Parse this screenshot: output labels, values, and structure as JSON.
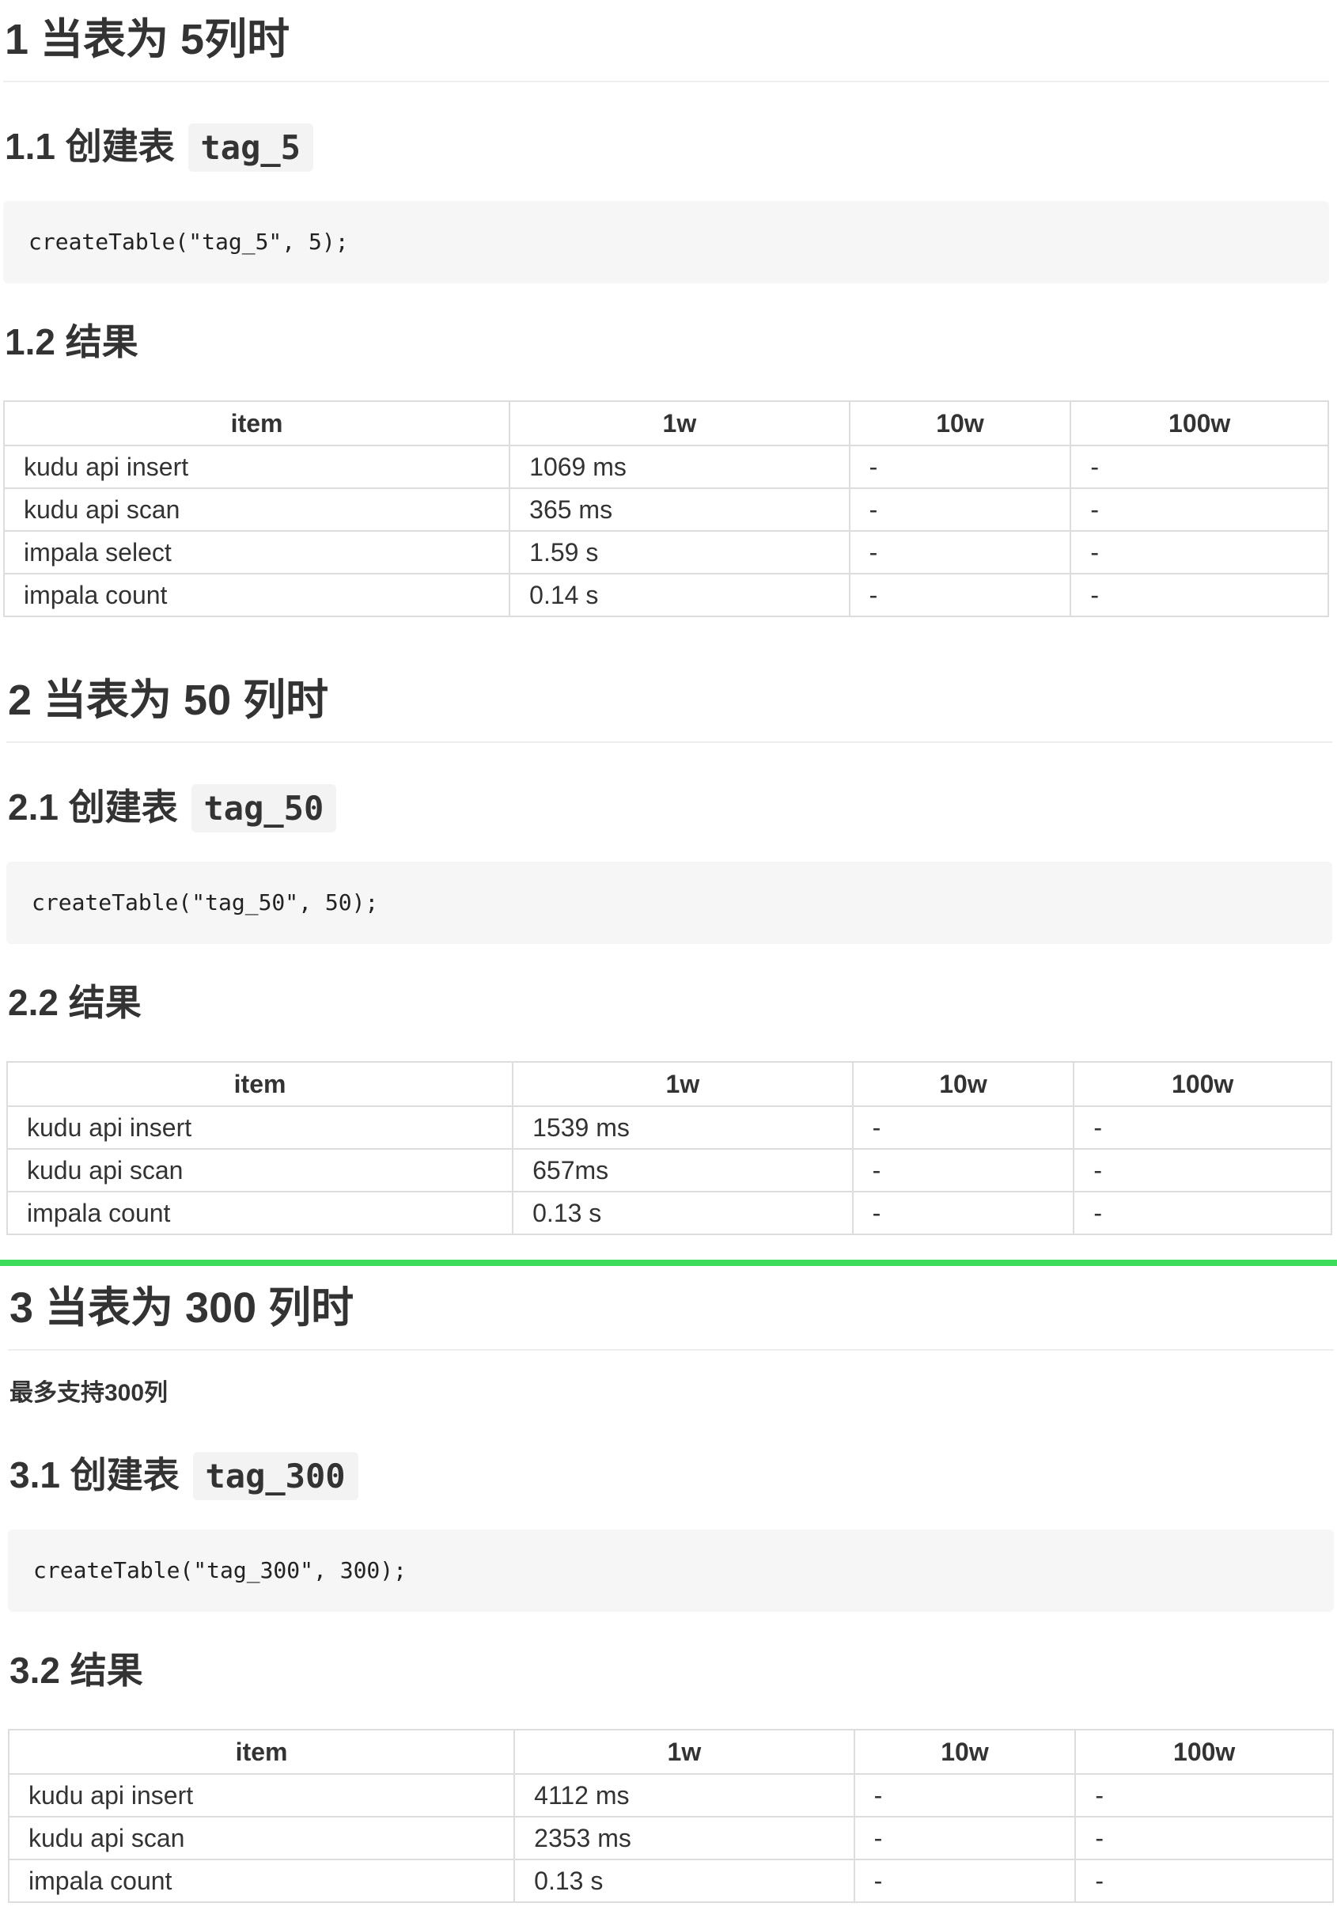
{
  "sections": [
    {
      "h1": "1 当表为 5列时",
      "create_heading": "1.1 创建表",
      "create_code_inline": "tag_5",
      "code": "createTable(\"tag_5\", 5);",
      "result_heading": "1.2 结果",
      "table": {
        "headers": [
          "item",
          "1w",
          "10w",
          "100w"
        ],
        "rows": [
          [
            "kudu api insert",
            "1069 ms",
            "-",
            "-"
          ],
          [
            "kudu api scan",
            "365 ms",
            "-",
            "-"
          ],
          [
            "impala select",
            "1.59 s",
            "-",
            "-"
          ],
          [
            "impala count",
            "0.14 s",
            "-",
            "-"
          ]
        ]
      }
    },
    {
      "h1": "2 当表为 50 列时",
      "create_heading": "2.1 创建表",
      "create_code_inline": "tag_50",
      "code": "createTable(\"tag_50\", 50);",
      "result_heading": "2.2 结果",
      "table": {
        "headers": [
          "item",
          "1w",
          "10w",
          "100w"
        ],
        "rows": [
          [
            "kudu api insert",
            "1539 ms",
            "-",
            "-"
          ],
          [
            "kudu api scan",
            "657ms",
            "-",
            "-"
          ],
          [
            "impala count",
            "0.13 s",
            "-",
            "-"
          ]
        ]
      }
    },
    {
      "h1": "3 当表为 300 列时",
      "note": "最多支持300列",
      "create_heading": "3.1 创建表",
      "create_code_inline": "tag_300",
      "code": "createTable(\"tag_300\", 300);",
      "result_heading": "3.2 结果",
      "table": {
        "headers": [
          "item",
          "1w",
          "10w",
          "100w"
        ],
        "rows": [
          [
            "kudu api insert",
            "4112 ms",
            "-",
            "-"
          ],
          [
            "kudu api scan",
            "2353 ms",
            "-",
            "-"
          ],
          [
            "impala count",
            "0.13 s",
            "-",
            "-"
          ]
        ]
      }
    }
  ],
  "colors": {
    "highlight_line": "#3ddc5a",
    "code_bg": "#f6f6f6",
    "border": "#dddddd"
  }
}
